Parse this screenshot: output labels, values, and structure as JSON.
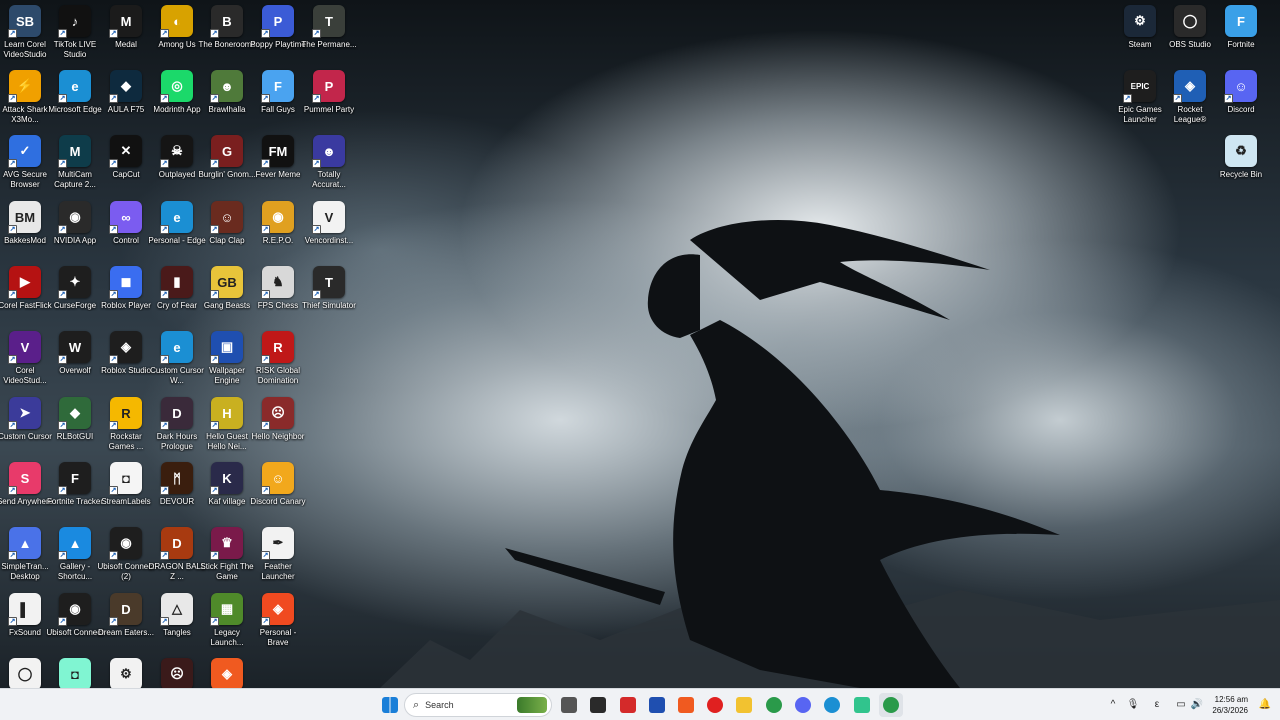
{
  "desktop": {
    "icons": [
      {
        "label": "Learn Corel VideoStudio",
        "icon": "corel-training-icon",
        "color": "#2d4a6b",
        "glyph": "SB"
      },
      {
        "label": "TikTok LIVE Studio",
        "icon": "tiktok-icon",
        "color": "#111111",
        "glyph": "♪"
      },
      {
        "label": "Medal",
        "icon": "medal-icon",
        "color": "#1b1b1b",
        "glyph": "M"
      },
      {
        "label": "Among Us",
        "icon": "among-us-icon",
        "color": "#d8a200",
        "glyph": "◐"
      },
      {
        "label": "The Bonerooms",
        "icon": "bonerooms-icon",
        "color": "#2a2a2a",
        "glyph": "B"
      },
      {
        "label": "Poppy Playtime",
        "icon": "poppy-playtime-icon",
        "color": "#3b5bd6",
        "glyph": "P"
      },
      {
        "label": "The Permane...",
        "icon": "permanence-icon",
        "color": "#3a3f3a",
        "glyph": "T"
      },
      {
        "label": "Attack Shark X3Mo...",
        "icon": "attack-shark-icon",
        "color": "#f0a000",
        "glyph": "⚡"
      },
      {
        "label": "Microsoft Edge",
        "icon": "edge-icon",
        "color": "#1b8fd3",
        "glyph": "e"
      },
      {
        "label": "AULA F75",
        "icon": "aula-icon",
        "color": "#0e2a3e",
        "glyph": "◆"
      },
      {
        "label": "Modrinth App",
        "icon": "modrinth-icon",
        "color": "#1bd96a",
        "glyph": "◎"
      },
      {
        "label": "Brawlhalla",
        "icon": "brawlhalla-icon",
        "color": "#4f7a3a",
        "glyph": "☻"
      },
      {
        "label": "Fall Guys",
        "icon": "fall-guys-icon",
        "color": "#4aa3f0",
        "glyph": "F"
      },
      {
        "label": "Pummel Party",
        "icon": "pummel-party-icon",
        "color": "#c2264b",
        "glyph": "P"
      },
      {
        "label": "AVG Secure Browser",
        "icon": "avg-browser-icon",
        "color": "#2f6fe0",
        "glyph": "✓"
      },
      {
        "label": "MultiCam Capture 2...",
        "icon": "multicam-icon",
        "color": "#0e3c4a",
        "glyph": "M"
      },
      {
        "label": "CapCut",
        "icon": "capcut-icon",
        "color": "#111111",
        "glyph": "✕"
      },
      {
        "label": "Outplayed",
        "icon": "outplayed-icon",
        "color": "#151515",
        "glyph": "☠"
      },
      {
        "label": "Burglin' Gnom...",
        "icon": "burglin-gnomes-icon",
        "color": "#7a1f1f",
        "glyph": "G"
      },
      {
        "label": "Fever Meme",
        "icon": "fever-meme-icon",
        "color": "#111111",
        "glyph": "FM"
      },
      {
        "label": "Totally Accurat...",
        "icon": "tabs-icon",
        "color": "#3a3aa0",
        "glyph": "☻"
      },
      {
        "label": "BakkesMod",
        "icon": "bakkesmod-icon",
        "color": "#e8e8e8",
        "glyph": "BM"
      },
      {
        "label": "NVIDIA App",
        "icon": "nvidia-icon",
        "color": "#2a2a2a",
        "glyph": "◉"
      },
      {
        "label": "Control",
        "icon": "control-icon",
        "color": "#7b5cf0",
        "glyph": "∞"
      },
      {
        "label": "Personal - Edge",
        "icon": "edge-personal-icon",
        "color": "#1b8fd3",
        "glyph": "e"
      },
      {
        "label": "Clap Clap",
        "icon": "clap-clap-icon",
        "color": "#6a2b1f",
        "glyph": "☺"
      },
      {
        "label": "R.E.P.O.",
        "icon": "repo-icon",
        "color": "#e0a020",
        "glyph": "◉"
      },
      {
        "label": "Vencordinst...",
        "icon": "vencord-icon",
        "color": "#f2f2f2",
        "glyph": "V"
      },
      {
        "label": "Corel FastFlick",
        "icon": "fastflick-icon",
        "color": "#b51212",
        "glyph": "▶"
      },
      {
        "label": "CurseForge",
        "icon": "curseforge-icon",
        "color": "#1e1e1e",
        "glyph": "✦"
      },
      {
        "label": "Roblox Player",
        "icon": "roblox-player-icon",
        "color": "#3a6df0",
        "glyph": "◼"
      },
      {
        "label": "Cry of Fear",
        "icon": "cry-of-fear-icon",
        "color": "#4a1a1a",
        "glyph": "▮"
      },
      {
        "label": "Gang Beasts",
        "icon": "gang-beasts-icon",
        "color": "#e8c43a",
        "glyph": "GB"
      },
      {
        "label": "FPS Chess",
        "icon": "fps-chess-icon",
        "color": "#d8d8d8",
        "glyph": "♞"
      },
      {
        "label": "Thief Simulator",
        "icon": "thief-sim-icon",
        "color": "#2a2a2a",
        "glyph": "T"
      },
      {
        "label": "Corel VideoStud...",
        "icon": "corel-videostudio-icon",
        "color": "#5a1f8a",
        "glyph": "V"
      },
      {
        "label": "Overwolf",
        "icon": "overwolf-icon",
        "color": "#1e1e1e",
        "glyph": "W"
      },
      {
        "label": "Roblox Studio",
        "icon": "roblox-studio-icon",
        "color": "#1e1e1e",
        "glyph": "◈"
      },
      {
        "label": "Custom Cursor W...",
        "icon": "custom-cursor-edge-icon",
        "color": "#1b8fd3",
        "glyph": "e"
      },
      {
        "label": "Wallpaper Engine",
        "icon": "wallpaper-engine-icon",
        "color": "#1f4fb0",
        "glyph": "▣"
      },
      {
        "label": "RISK Global Domination",
        "icon": "risk-icon",
        "color": "#c01818",
        "glyph": "R"
      },
      {
        "label": "Custom Cursor",
        "icon": "custom-cursor-icon",
        "color": "#3b3b9a",
        "glyph": "➤"
      },
      {
        "label": "RLBotGUI",
        "icon": "rlbot-icon",
        "color": "#2f6a3a",
        "glyph": "◆"
      },
      {
        "label": "Rockstar Games ...",
        "icon": "rockstar-icon",
        "color": "#f5b800",
        "glyph": "R"
      },
      {
        "label": "Dark Hours Prologue",
        "icon": "dark-hours-icon",
        "color": "#3a2a3a",
        "glyph": "D"
      },
      {
        "label": "Hello Guest Hello Nei...",
        "icon": "hello-guest-icon",
        "color": "#c9b020",
        "glyph": "H"
      },
      {
        "label": "Hello Neighbor",
        "icon": "hello-neighbor-icon",
        "color": "#8a2a2a",
        "glyph": "☹"
      },
      {
        "label": "Send Anywhere",
        "icon": "send-anywhere-icon",
        "color": "#e83a6a",
        "glyph": "S"
      },
      {
        "label": "Fortnite Tracker",
        "icon": "fortnite-tracker-icon",
        "color": "#1e1e1e",
        "glyph": "F"
      },
      {
        "label": "StreamLabels",
        "icon": "streamlabels-icon",
        "color": "#f5f5f5",
        "glyph": "◘"
      },
      {
        "label": "DEVOUR",
        "icon": "devour-icon",
        "color": "#3a1e0e",
        "glyph": "ᛗ"
      },
      {
        "label": "Kaf village",
        "icon": "kaf-village-icon",
        "color": "#2a2a4a",
        "glyph": "K"
      },
      {
        "label": "Discord Canary",
        "icon": "discord-canary-icon",
        "color": "#f2a81c",
        "glyph": "☺"
      },
      {
        "label": "SimpleTran... Desktop",
        "icon": "simpletransfer-icon",
        "color": "#4a72e8",
        "glyph": "▲"
      },
      {
        "label": "Gallery - Shortcu...",
        "icon": "gallery-icon",
        "color": "#1a8ae0",
        "glyph": "▲"
      },
      {
        "label": "Ubisoft Connect (2)",
        "icon": "ubisoft-connect-2-icon",
        "color": "#1e1e1e",
        "glyph": "◉"
      },
      {
        "label": "DRAGON BALL Z ...",
        "icon": "dragon-ball-icon",
        "color": "#a83a10",
        "glyph": "D"
      },
      {
        "label": "Stick Fight The Game",
        "icon": "stick-fight-icon",
        "color": "#7a1a4a",
        "glyph": "♛"
      },
      {
        "label": "Feather Launcher",
        "icon": "feather-launcher-icon",
        "color": "#f2f2f2",
        "glyph": "✒"
      },
      {
        "label": "FxSound",
        "icon": "fxsound-icon",
        "color": "#f2f2f2",
        "glyph": "▌"
      },
      {
        "label": "Ubisoft Connect",
        "icon": "ubisoft-connect-icon",
        "color": "#1e1e1e",
        "glyph": "◉"
      },
      {
        "label": "Dream Eaters...",
        "icon": "dream-eaters-icon",
        "color": "#4a3a2a",
        "glyph": "D"
      },
      {
        "label": "Tangles",
        "icon": "tangles-icon",
        "color": "#e8e8e8",
        "glyph": "△"
      },
      {
        "label": "Legacy Launch...",
        "icon": "legacy-launcher-icon",
        "color": "#4f8a2a",
        "glyph": "▦"
      },
      {
        "label": "Personal - Brave",
        "icon": "brave-personal-icon",
        "color": "#f04a20",
        "glyph": "◈"
      },
      {
        "label": "",
        "icon": "obs-small-icon",
        "color": "#f2f2f2",
        "glyph": "◯"
      },
      {
        "label": "",
        "icon": "streamlabs-icon",
        "color": "#80f5d2",
        "glyph": "◘"
      },
      {
        "label": "",
        "icon": "chatgpt-icon",
        "color": "#f2f2f2",
        "glyph": "⚙"
      },
      {
        "label": "",
        "icon": "horror-game-icon",
        "color": "#3a1a1a",
        "glyph": "☹"
      },
      {
        "label": "",
        "icon": "brave-icon",
        "color": "#f05a20",
        "glyph": "◈"
      },
      {
        "label": "Steam",
        "icon": "steam-icon",
        "color": "#1b2838",
        "glyph": "⚙"
      },
      {
        "label": "OBS Studio",
        "icon": "obs-studio-icon",
        "color": "#2a2a2a",
        "glyph": "◯"
      },
      {
        "label": "Fortnite",
        "icon": "fortnite-icon",
        "color": "#3aa0e8",
        "glyph": "F"
      },
      {
        "label": "Epic Games Launcher",
        "icon": "epic-games-icon",
        "color": "#1e1e1e",
        "glyph": "EPIC"
      },
      {
        "label": "Rocket League®",
        "icon": "rocket-league-icon",
        "color": "#1f5fb5",
        "glyph": "◈"
      },
      {
        "label": "Discord",
        "icon": "discord-icon",
        "color": "#5865f2",
        "glyph": "☺"
      },
      {
        "label": "Recycle Bin",
        "icon": "recycle-bin-icon",
        "color": "#cfe6f2",
        "glyph": "♻"
      }
    ]
  },
  "taskbar": {
    "search_placeholder": "Search",
    "apps": [
      {
        "icon": "windows-start-icon",
        "color": "#1a7fd8"
      },
      {
        "icon": "task-view-icon",
        "color": "#555555"
      },
      {
        "icon": "record-app-icon",
        "color": "#2a2a2a"
      },
      {
        "icon": "vivaldi-icon",
        "color": "#d42a2a"
      },
      {
        "icon": "wallpaper-engine-taskbar-icon",
        "color": "#1f4fb0"
      },
      {
        "icon": "brave-taskbar-icon",
        "color": "#f05a20"
      },
      {
        "icon": "youtube-icon",
        "color": "#e02020"
      },
      {
        "icon": "file-explorer-icon",
        "color": "#f2c230"
      },
      {
        "icon": "chrome-icon",
        "color": "#2a9a4a"
      },
      {
        "icon": "discord-taskbar-icon",
        "color": "#5865f2"
      },
      {
        "icon": "edge-taskbar-icon",
        "color": "#1b8fd3"
      },
      {
        "icon": "streamlabs-taskbar-icon",
        "color": "#31c48d"
      },
      {
        "icon": "chrome-active-icon",
        "color": "#2a9a4a"
      }
    ],
    "clock": {
      "time": "12:56 am",
      "date": "26/3/2026"
    }
  }
}
